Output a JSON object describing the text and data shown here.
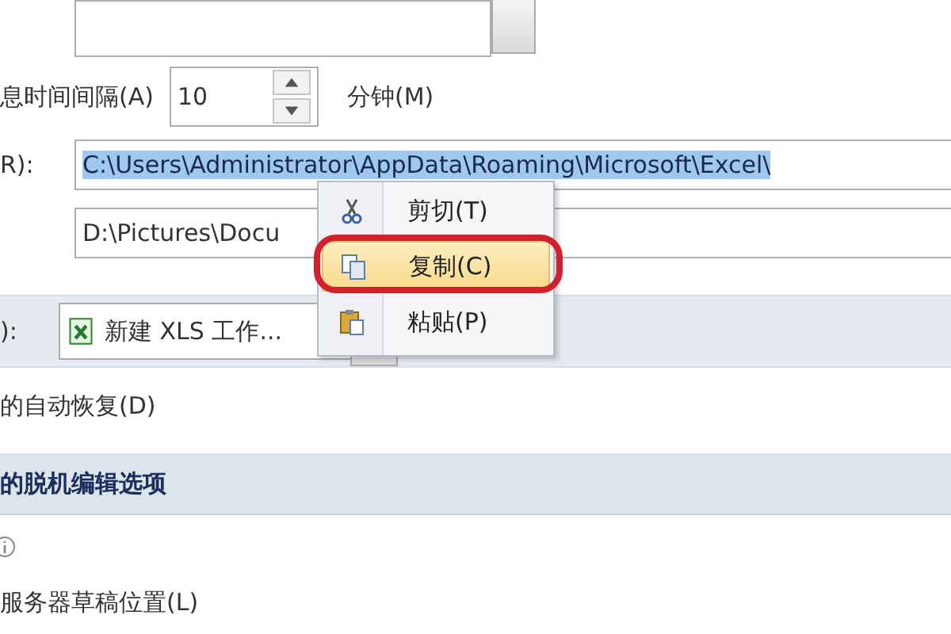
{
  "autosave_interval": {
    "label": "息时间间隔(A)",
    "value": "10",
    "unit": "分钟(M)"
  },
  "autorecover_location": {
    "label": "R):",
    "value": "C:\\Users\\Administrator\\AppData\\Roaming\\Microsoft\\Excel\\",
    "selected": true
  },
  "default_location": {
    "value": "D:\\Pictures\\Docu"
  },
  "exceptions": {
    "label": "):",
    "workbook": "新建 XLS 工作..."
  },
  "disable_autorecover": {
    "label": "的自动恢复(D)"
  },
  "section": {
    "title": "的脱机编辑选项"
  },
  "server_drafts": {
    "label": "服务器草稿位置(L)"
  },
  "context_menu": {
    "items": [
      {
        "kind": "cut",
        "label": "剪切(T)",
        "selected": false,
        "circled": false
      },
      {
        "kind": "copy",
        "label": "复制(C)",
        "selected": true,
        "circled": true
      },
      {
        "kind": "paste",
        "label": "粘贴(P)",
        "selected": false,
        "circled": false
      }
    ]
  }
}
